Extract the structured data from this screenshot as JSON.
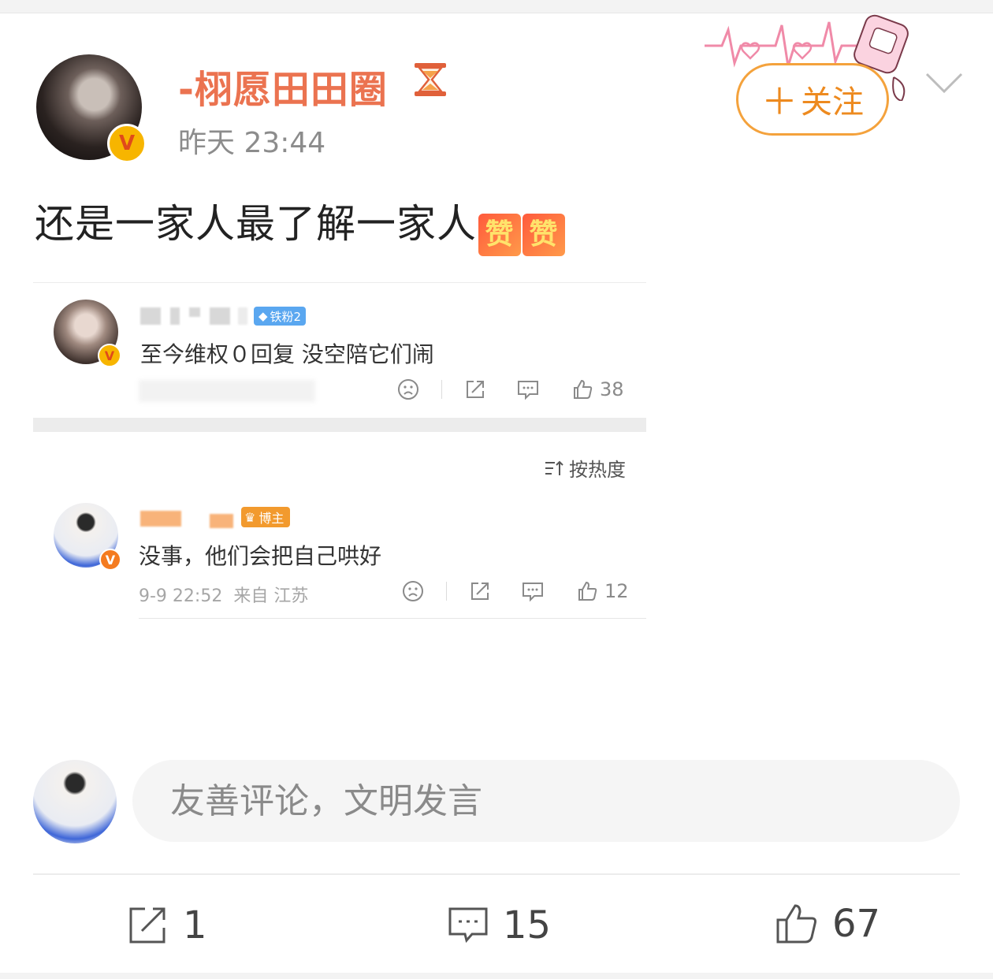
{
  "post": {
    "author_name": "-栩愿田田圈",
    "time": "昨天 23:44",
    "text": "还是一家人最了解一家人",
    "emoji_label": "赞",
    "verified_mark": "V",
    "follow_label": "关注",
    "follow_plus": "＋"
  },
  "quoted_comment": {
    "badge": "铁粉2",
    "text": "至今维权０回复 没空陪它们闹",
    "likes": "38"
  },
  "sort": {
    "label": "按热度"
  },
  "comments": [
    {
      "badge": "博主",
      "text": "没事，他们会把自己哄好",
      "date": "9-9 22:52",
      "location": "来自 江苏",
      "likes": "12"
    }
  ],
  "composer": {
    "placeholder": "友善评论，文明发言"
  },
  "bottom_bar": {
    "reposts": "1",
    "comments": "15",
    "likes": "67"
  },
  "icons": {
    "hourglass": "hourglass-icon",
    "chevron": "chevron-down-icon",
    "dislike": "frown-face-icon",
    "share": "share-icon",
    "comment": "comment-bubble-icon",
    "like": "thumbs-up-icon"
  },
  "colors": {
    "accent_orange": "#eb7350",
    "follow_orange": "#ed8a1f",
    "fan_blue": "#5aa7f0"
  }
}
